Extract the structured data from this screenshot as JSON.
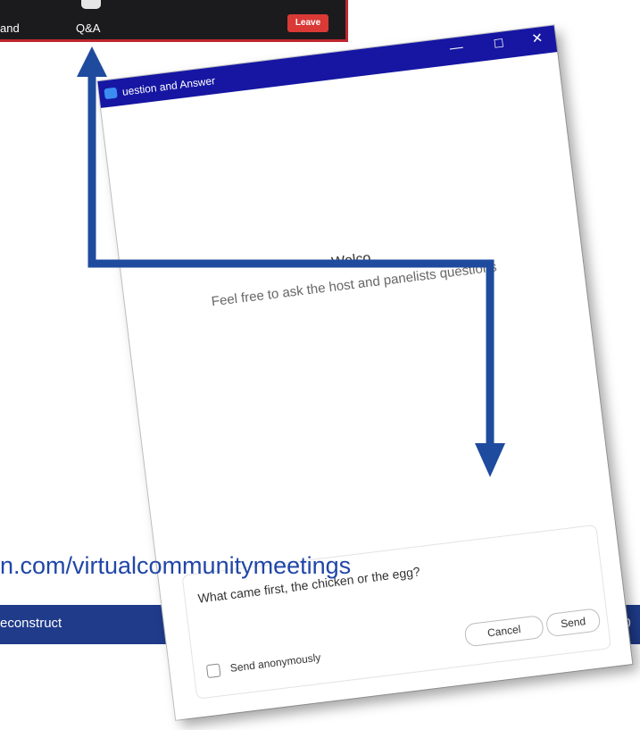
{
  "toolbar": {
    "hand_label": "and",
    "qa_label": "Q&A",
    "leave_label": "Leave"
  },
  "window": {
    "title": "uestion and Answer",
    "minimize": "—",
    "maximize": "☐",
    "close": "✕"
  },
  "welcome": {
    "title": "Welco",
    "subtitle": "Feel free to ask the host and panelists questions"
  },
  "compose": {
    "question_value": "What came first, the chicken or the egg?",
    "anonymous_label": "Send anonymously",
    "cancel_label": "Cancel",
    "send_label": "Send"
  },
  "overlay": {
    "url_text": "n.com/virtualcommunitymeetings"
  },
  "footer": {
    "left_text": "econstruct",
    "right_text": "20"
  },
  "colors": {
    "accent_blue": "#1f3b8a",
    "arrow_blue": "#1f4b9e",
    "titlebar": "#1616a3",
    "leave_red": "#d93a36"
  }
}
